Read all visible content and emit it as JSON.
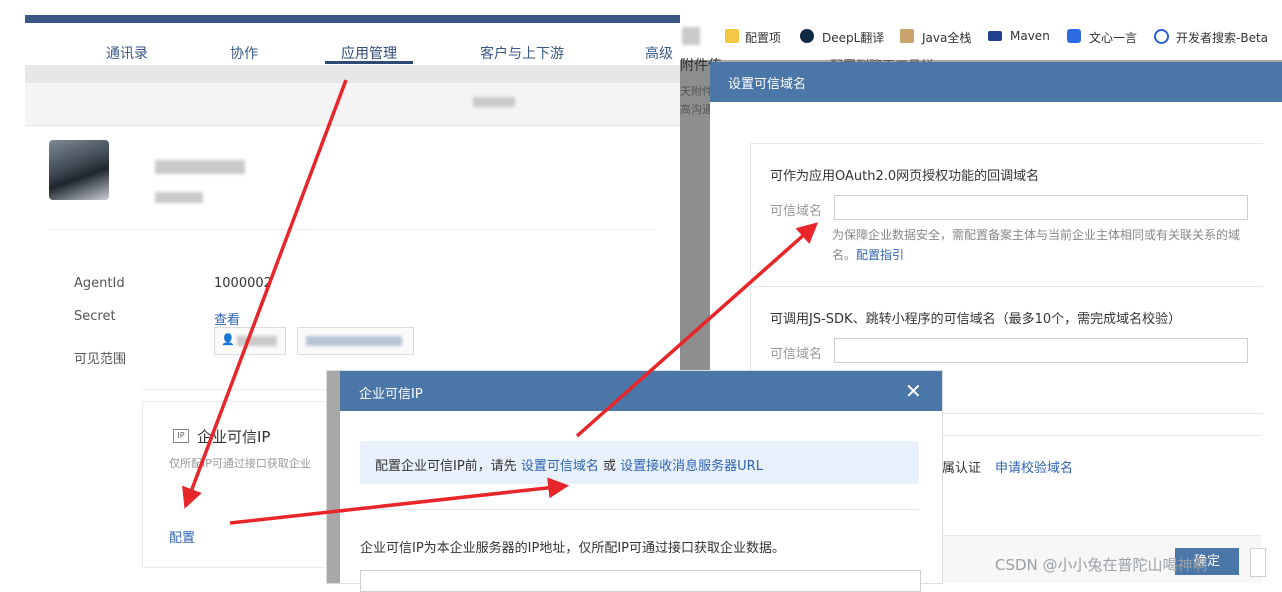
{
  "nav": {
    "tabs": [
      "通讯录",
      "协作",
      "应用管理",
      "客户与上下游",
      "高级"
    ],
    "active_index": 2
  },
  "app": {
    "agentid_label": "AgentId",
    "agentid_value": "1000002",
    "secret_label": "Secret",
    "secret_link": "查看",
    "visible_label": "可见范围"
  },
  "ip_card": {
    "icon_text": "IP",
    "title": "企业可信IP",
    "desc": "仅所配IP可通过接口获取企业",
    "config_link": "配置"
  },
  "browser_bookmarks": [
    {
      "label": "配置项",
      "icon": "folder-icon"
    },
    {
      "label": "DeepL翻译",
      "icon": "deepl-icon"
    },
    {
      "label": "Java全栈",
      "icon": "java-icon"
    },
    {
      "label": "Maven",
      "icon": "maven-icon"
    },
    {
      "label": "文心一言",
      "icon": "wenxin-icon"
    },
    {
      "label": "开发者搜索-Beta",
      "icon": "dev-search-icon"
    }
  ],
  "background_fragments": {
    "attachment": "附件传",
    "line1": "天附件",
    "line2": "高沟通",
    "card_tail": "配置到聊天工具栏"
  },
  "trusted_domain_dialog": {
    "title": "设置可信域名",
    "oauth_section": {
      "heading": "可作为应用OAuth2.0网页授权功能的回调域名",
      "field_label": "可信域名",
      "field_value": "",
      "hint": "为保障企业数据安全，需配置备案主体与当前企业主体相同或有关联关系的域名。",
      "guide_link": "配置指引"
    },
    "jssdk_section": {
      "heading": "可调用JS-SDK、跳转小程序的可信域名（最多10个，需完成域名校验）",
      "field_label": "可信域名",
      "field_value": ""
    },
    "verify_text": "属认证",
    "verify_link": "申请校验域名",
    "confirm_button": "确定"
  },
  "ip_dialog": {
    "title": "企业可信IP",
    "close_symbol": "✕",
    "info_prefix": "配置企业可信IP前，请先",
    "info_link1": "设置可信域名",
    "info_or": "或",
    "info_link2": "设置接收消息服务器URL",
    "desc": "企业可信IP为本企业服务器的IP地址，仅所配IP可通过接口获取企业数据。"
  },
  "watermark": "CSDN @小小兔在普陀山喝神啊",
  "colors": {
    "header_blue": "#4b76a8",
    "link_blue": "#2f63b3",
    "arrow_red": "#e8262a",
    "info_bg": "#e8f1fb"
  }
}
